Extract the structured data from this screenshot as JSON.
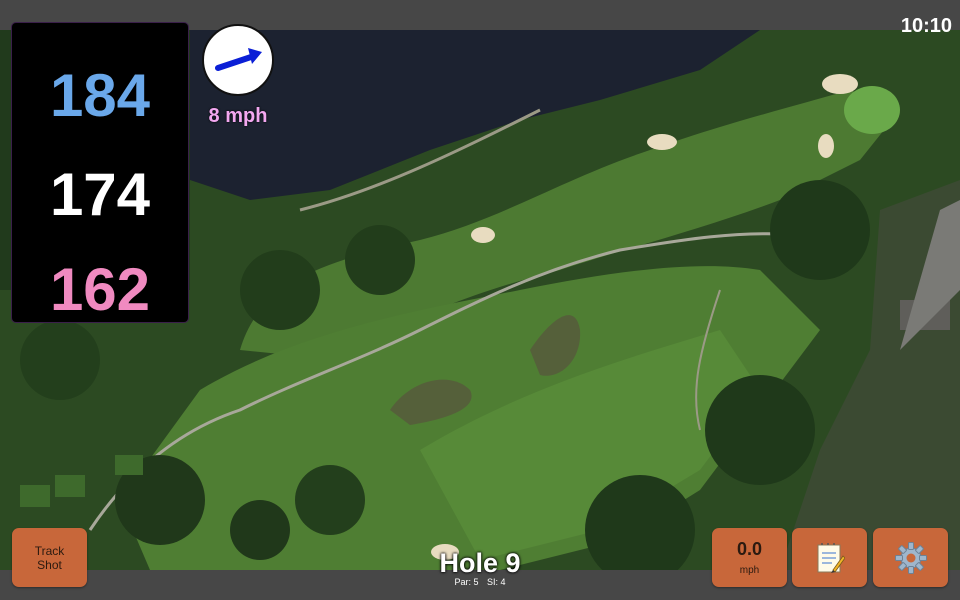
{
  "status": {
    "time": "10:10"
  },
  "distances": {
    "back": "184",
    "middle": "174",
    "front": "162"
  },
  "wind": {
    "speed_label": "8 mph",
    "direction_icon": "wind-arrow-icon"
  },
  "hole": {
    "title": "Hole 9",
    "par_label": "Par: 5",
    "si_label": "SI: 4"
  },
  "buttons": {
    "track_shot_line1": "Track",
    "track_shot_line2": "Shot",
    "wind_value": "0.0",
    "wind_unit": "mph",
    "notes_icon": "notepad-icon",
    "settings_icon": "gear-icon"
  },
  "colors": {
    "back_distance": "#6aa8ea",
    "middle_distance": "#ffffff",
    "front_distance": "#f08ac0",
    "wind_label": "#f3a8f0",
    "button_bg": "#c8673a"
  }
}
